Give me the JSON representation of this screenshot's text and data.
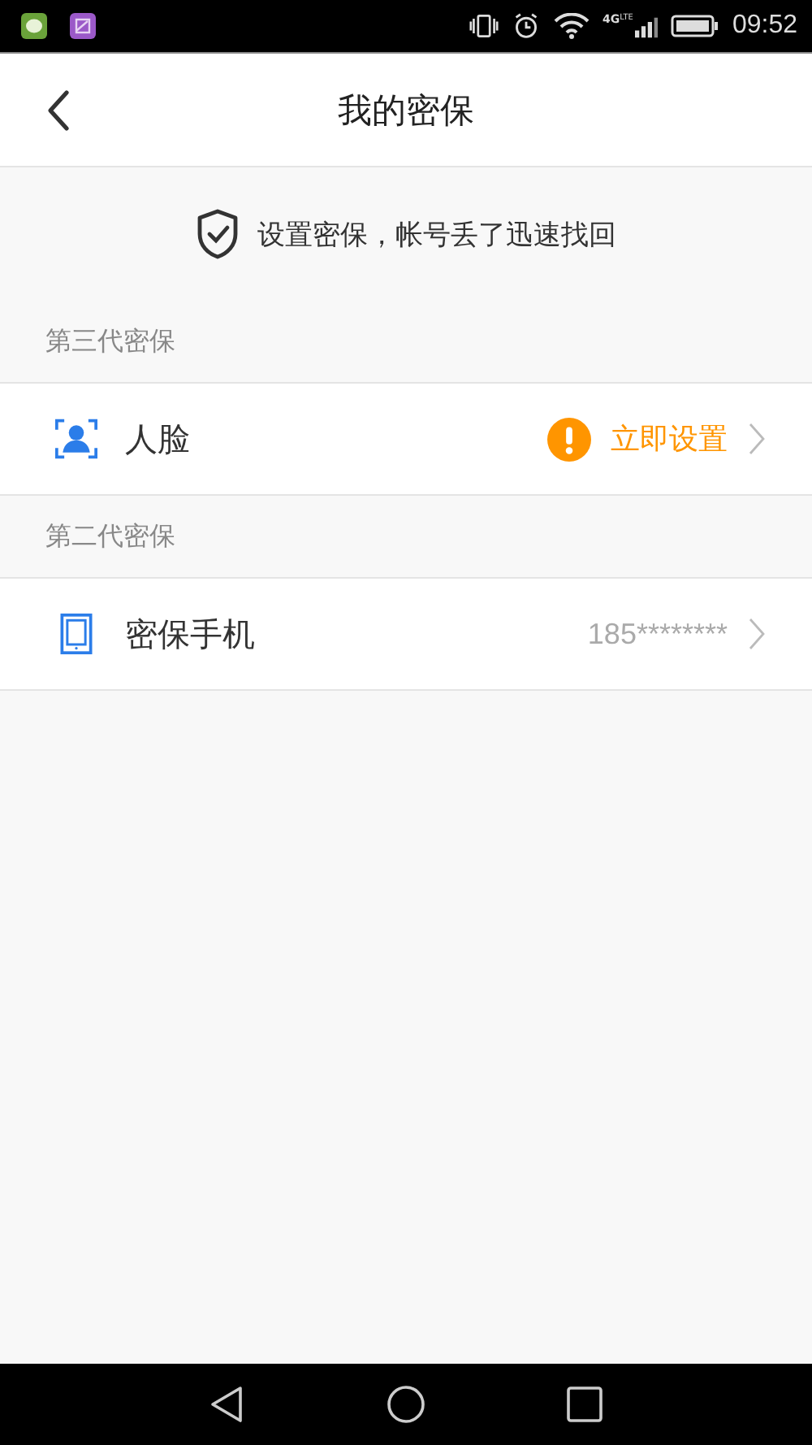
{
  "status_bar": {
    "network": "4G",
    "network_sub": "LTE",
    "time": "09:52"
  },
  "header": {
    "title": "我的密保"
  },
  "banner": {
    "text": "设置密保，帐号丢了迅速找回"
  },
  "sections": [
    {
      "title": "第三代密保",
      "rows": [
        {
          "kind": "face",
          "label": "人脸",
          "detail": {
            "kind": "alert",
            "text": "立即设置"
          }
        }
      ]
    },
    {
      "title": "第二代密保",
      "rows": [
        {
          "kind": "phone",
          "label": "密保手机",
          "detail": {
            "kind": "plain",
            "text": "185********"
          }
        }
      ]
    }
  ]
}
